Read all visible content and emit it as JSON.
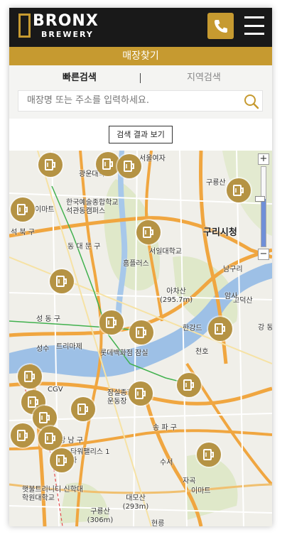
{
  "header": {
    "logo_main": "BRONX",
    "logo_sub": "BREWERY",
    "phone_icon": "phone-icon",
    "menu_icon": "hamburger-menu-icon"
  },
  "page": {
    "title": "매장찾기"
  },
  "tabs": [
    {
      "label": "빠른검색",
      "active": true
    },
    {
      "label": "지역검색",
      "active": false
    }
  ],
  "search": {
    "placeholder": "매장명 또는 주소를 입력하세요.",
    "value": ""
  },
  "result_button": "검색 결과 보기",
  "map": {
    "labels": [
      "서울여자",
      "광운대학교",
      "구룡산",
      "이마트",
      "한국예술종합학교 석관동캠퍼스",
      "석 북 구",
      "구리시청",
      "동 대 문 구",
      "서일대학교",
      "홈플러스",
      "남구리",
      "아차산 (295.7m)",
      "성 동 구",
      "한강드",
      "고덕산",
      "암사",
      "강 동",
      "트리마제",
      "롯데백화점 잠실",
      "천호",
      "성수",
      "CGV",
      "잠실종합 운동장",
      "송 파 구",
      "강 남 구",
      "타워팰리스 1차",
      "수서",
      "자곡",
      "이마트",
      "햇불트리니티 신학대학원대학교",
      "구룡산 (306m)",
      "대모산 (293m)",
      "현릉"
    ],
    "store_pin_icon": "beer-mug-icon",
    "zoom_level": 0.6
  },
  "colors": {
    "accent": "#c69a30",
    "header": "#191919",
    "pin": "#b59344"
  }
}
